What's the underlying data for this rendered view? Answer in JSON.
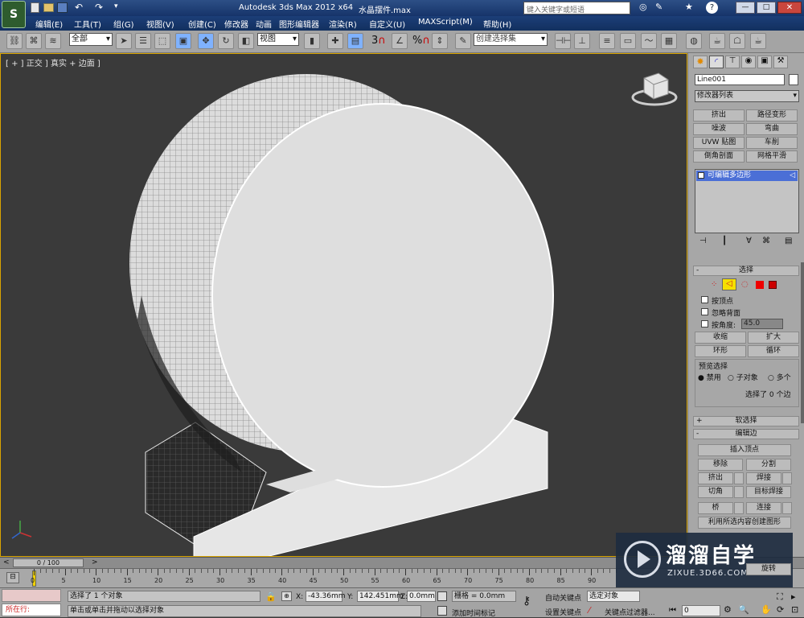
{
  "window": {
    "title": "Autodesk 3ds Max  2012 x64",
    "file": "水晶摆件.max",
    "search_placeholder": "键入关键字或短语"
  },
  "menu": [
    "编辑(E)",
    "工具(T)",
    "组(G)",
    "视图(V)",
    "创建(C)",
    "修改器",
    "动画",
    "图形编辑器",
    "渲染(R)",
    "自定义(U)",
    "MAXScript(M)",
    "帮助(H)"
  ],
  "toolbar": {
    "selection_filter": "全部",
    "coord_system": "视图",
    "snap_numbers": [
      "3",
      "%"
    ],
    "named_selection": "创建选择集"
  },
  "viewport": {
    "label": "[ + ] 正交 ] 真实 + 边面 ]"
  },
  "command_panel": {
    "object_name": "Line001",
    "modifier_list": "修改器列表",
    "modifier_buttons": [
      "挤出",
      "路径变形",
      "噪波",
      "弯曲",
      "UVW 贴图",
      "车削",
      "倒角剖面",
      "网格平滑"
    ],
    "stack_item": "可编辑多边形",
    "selection_title": "选择",
    "by_vertex": "按顶点",
    "ignore_backface": "忽略背面",
    "by_angle": "按角度:",
    "angle_value": "45.0",
    "shrink": "收缩",
    "grow": "扩大",
    "ring": "环形",
    "loop": "循环",
    "preview_title": "预览选择",
    "preview_options": [
      "禁用",
      "子对象",
      "多个"
    ],
    "selected_count": "选择了 0 个边",
    "soft_selection": "软选择",
    "edit_edges": "编辑边",
    "insert_vertex": "插入顶点",
    "remove": "移除",
    "split": "分割",
    "extrude": "挤出",
    "weld": "焊接",
    "chamfer": "切角",
    "target_weld": "目标焊接",
    "bridge": "桥",
    "connect": "连接",
    "create_shape": "利用所选内容创建图形",
    "rotate": "旋转"
  },
  "timeline": {
    "frame_counter": "0 / 100",
    "ticks": [
      "0",
      "5",
      "10",
      "15",
      "20",
      "25",
      "30",
      "35",
      "40",
      "45",
      "50",
      "55",
      "60",
      "65",
      "70",
      "75",
      "80",
      "85",
      "90"
    ]
  },
  "status": {
    "running": "所在行:",
    "selected": "选择了 1 个对象",
    "hint": "单击或单击并拖动以选择对象",
    "x_label": "X:",
    "x_value": "-43.36mm",
    "y_label": "Y:",
    "y_value": "142.451mm",
    "z_label": "Z:",
    "z_value": "0.0mm",
    "grid": "栅格 = 0.0mm",
    "add_time_tag": "添加时间标记",
    "auto_key": "自动关键点",
    "set_key": "设置关键点",
    "selected_object": "选定对象",
    "key_filters": "关键点过滤器...",
    "frame": "0"
  },
  "watermark": {
    "brand": "溜溜自学",
    "url": "ZIXUE.3D66.COM"
  }
}
